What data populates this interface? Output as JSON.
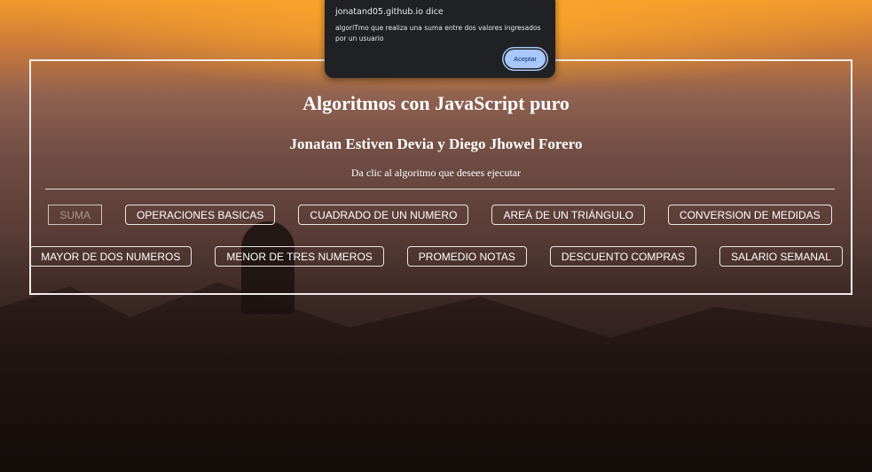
{
  "page": {
    "title": "Algoritmos con JavaScript puro",
    "authors": "Jonatan Estiven Devia y Diego Jhowel Forero",
    "instruction": "Da clic al algoritmo que desees ejecutar"
  },
  "buttons": {
    "row1": [
      "SUMA",
      "OPERACIONES BASICAS",
      "CUADRADO DE UN NUMERO",
      "AREÁ DE UN TRIÁNGULO",
      "CONVERSION DE MEDIDAS"
    ],
    "row2": [
      "MAYOR DE DOS NUMEROS",
      "MENOR DE TRES NUMEROS",
      "PROMEDIO NOTAS",
      "DESCUENTO COMPRAS",
      "SALARIO SEMANAL"
    ]
  },
  "dialog": {
    "title": "jonatand05.github.io dice",
    "message": "algoriTmo que realiza una suma entre dos valores ingresados por un usuario",
    "accept_label": "Aceptar"
  }
}
